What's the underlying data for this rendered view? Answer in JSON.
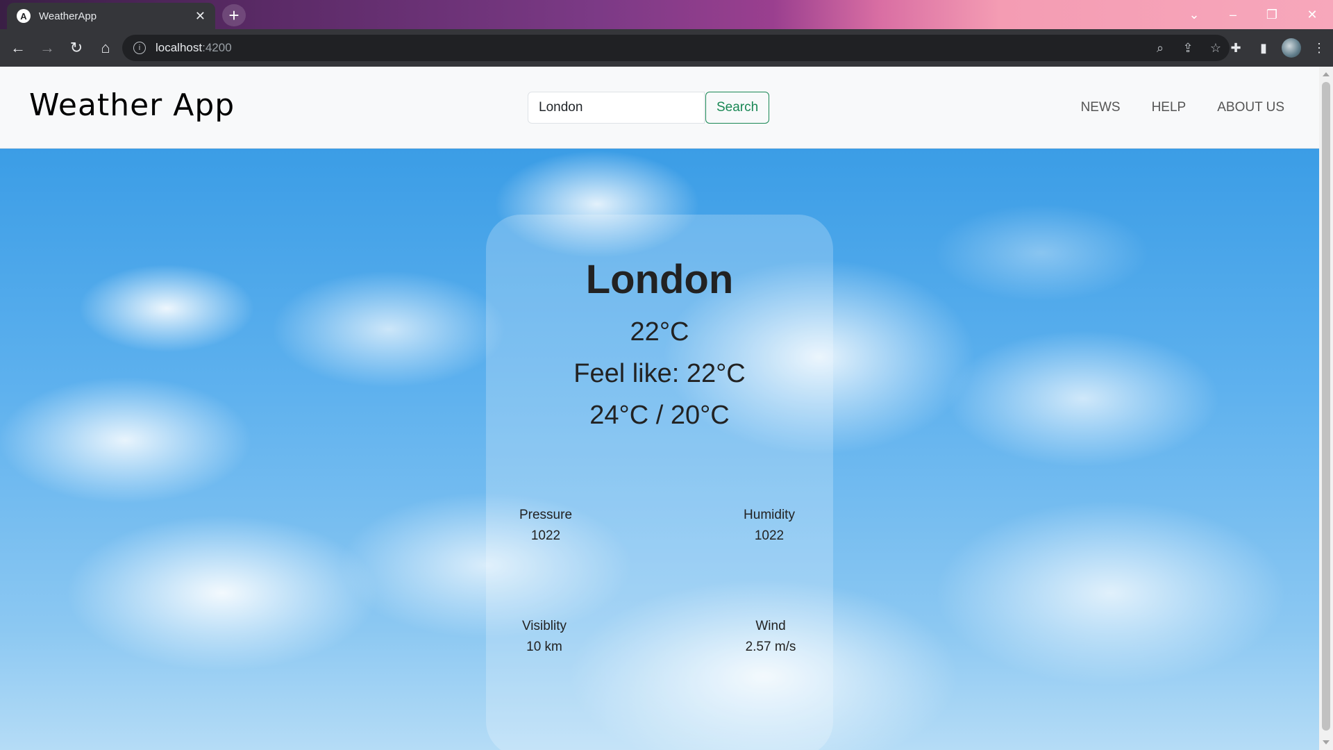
{
  "browser": {
    "tab_title": "WeatherApp",
    "tab_favicon_letter": "A",
    "url_host": "localhost",
    "url_port": ":4200"
  },
  "navbar": {
    "brand": "Weather App",
    "search": {
      "value": "London",
      "button_label": "Search"
    },
    "links": [
      "NEWS",
      "HELP",
      "ABOUT US"
    ]
  },
  "weather": {
    "city": "London",
    "temperature": "22°C",
    "feels_like": "Feel like: 22°C",
    "min_max": "24°C / 20°C",
    "stats": {
      "pressure": {
        "label": "Pressure",
        "value": "1022"
      },
      "humidity": {
        "label": "Humidity",
        "value": "1022"
      },
      "visibility": {
        "label": "Visiblity",
        "value": "10 km"
      },
      "wind": {
        "label": "Wind",
        "value": "2.57 m/s"
      }
    }
  },
  "colors": {
    "search_button": "#198754",
    "navbar_bg": "#f8f9fa"
  }
}
